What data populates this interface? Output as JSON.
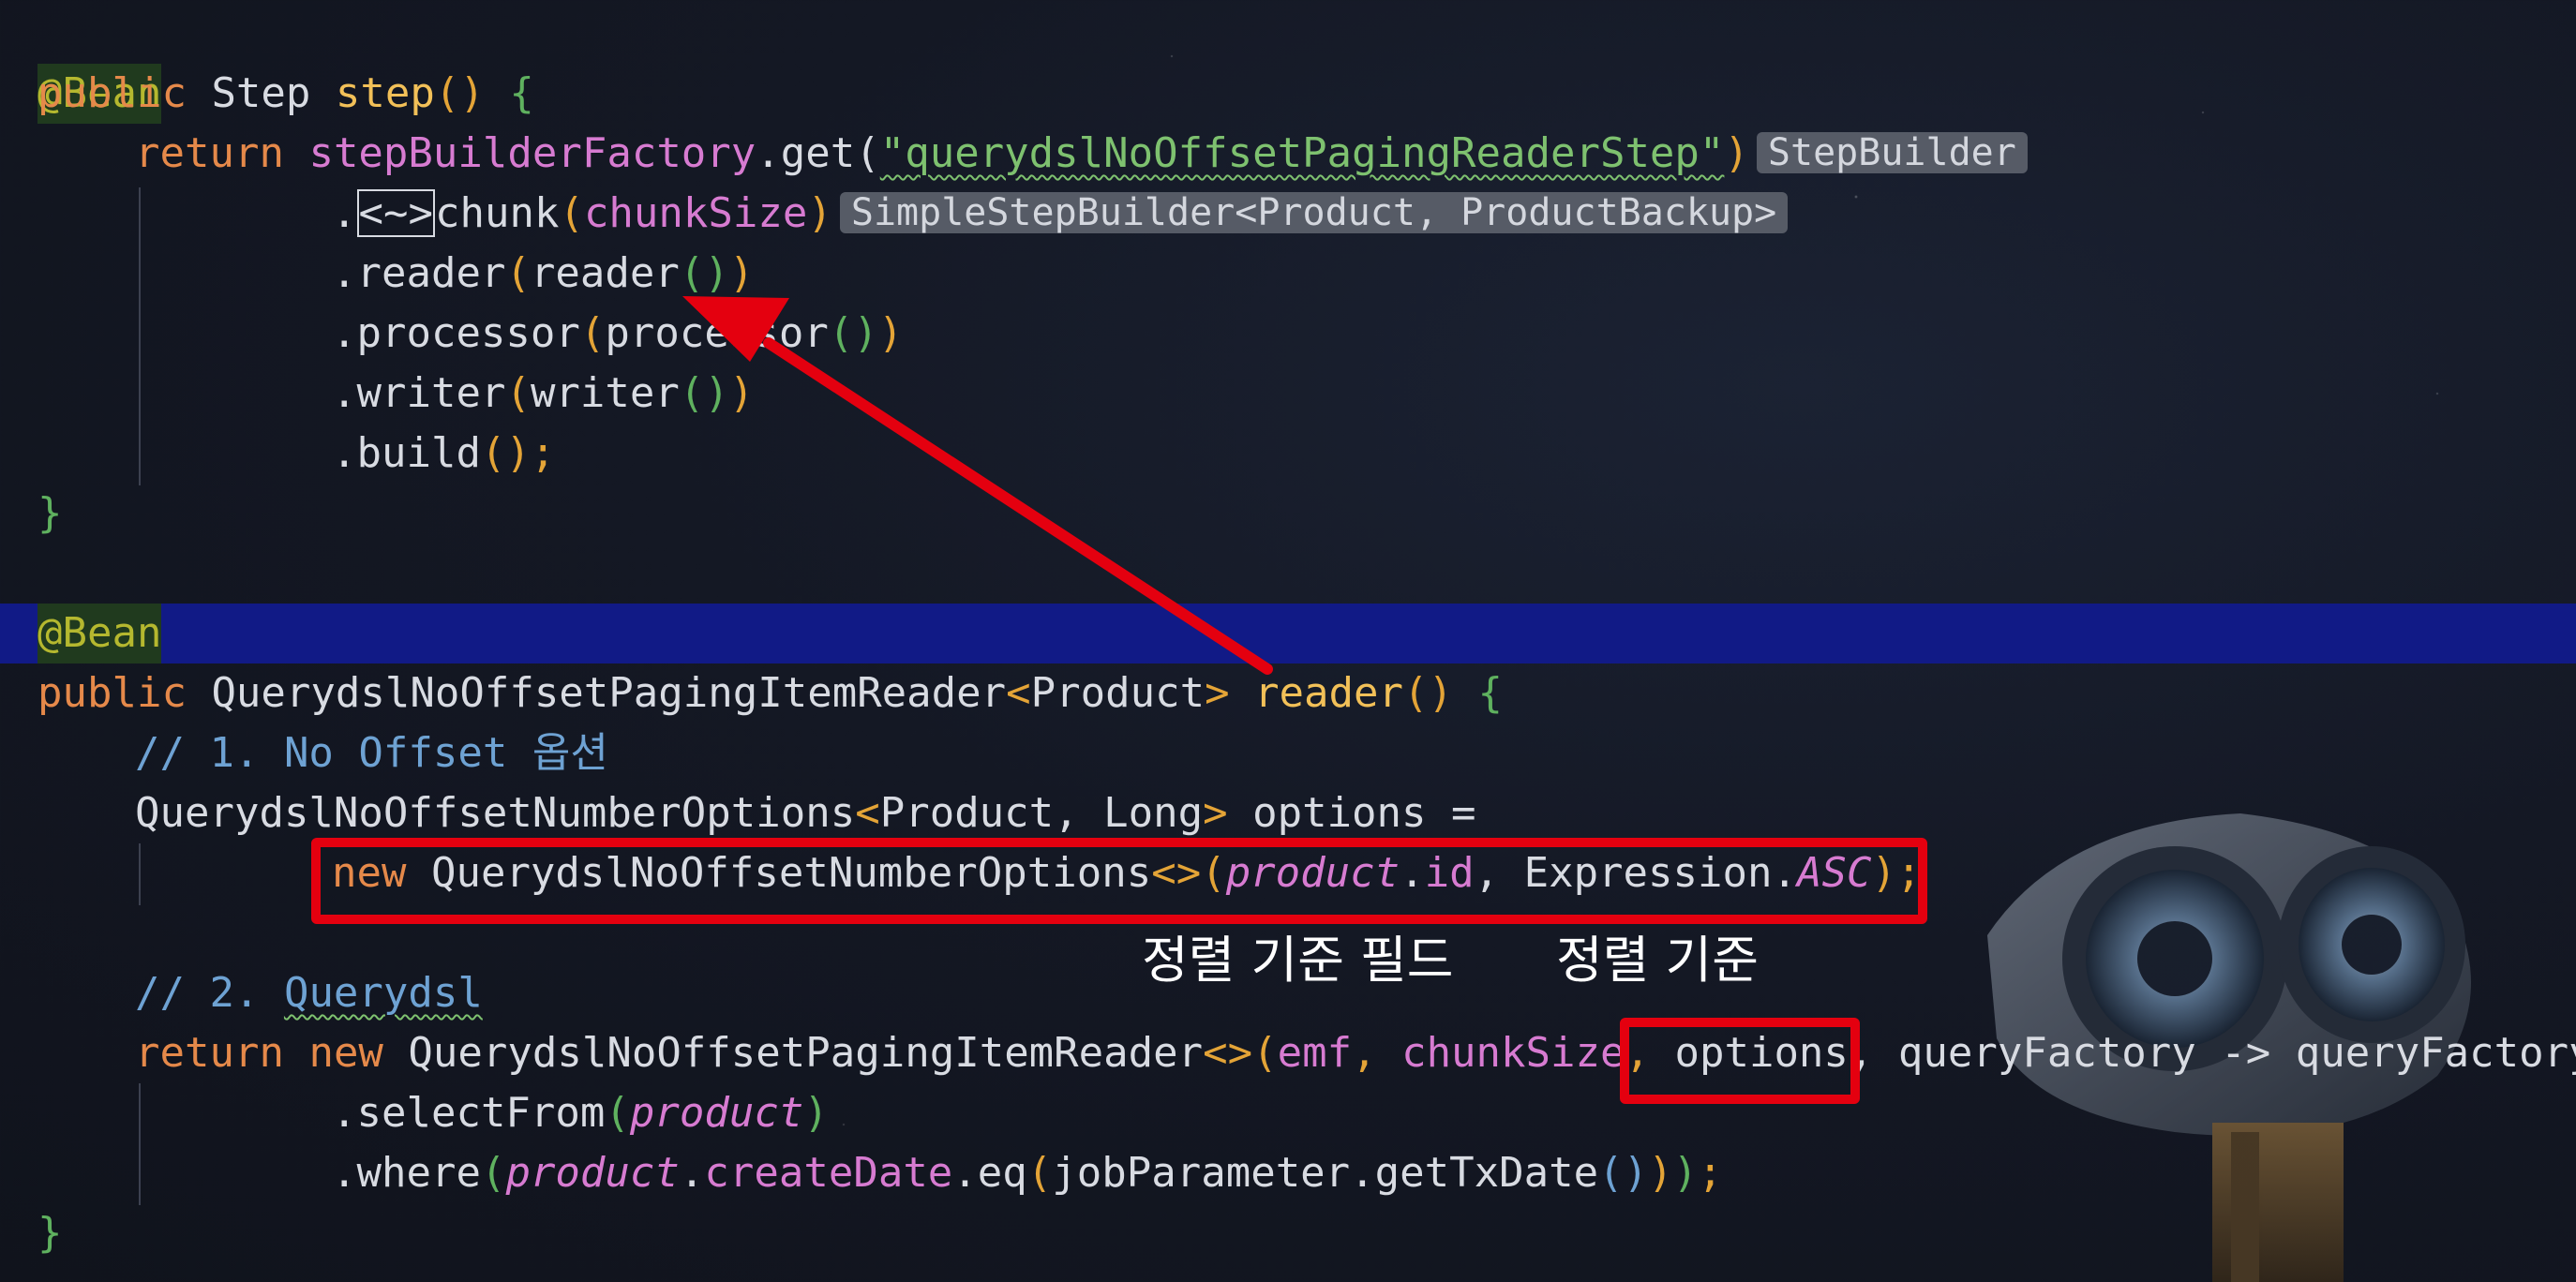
{
  "colors": {
    "background": "#141824",
    "keyword": "#e5894a",
    "method": "#f2c058",
    "field": "#d77bd1",
    "string": "#7ec16f",
    "comment": "#6ea2d3",
    "selected_line": "#111a86",
    "annotation_red": "#e4000f"
  },
  "code": {
    "l1": {
      "ann": "@Bean"
    },
    "l2": {
      "kw": "public",
      "t1": " Step ",
      "fn": "step",
      "t2": "() ",
      "br": "{"
    },
    "l3": {
      "kw": "return",
      "fld": "stepBuilderFactory",
      "t1": ".get(",
      "str": "\"querydslNoOffsetPagingReaderStep\"",
      "t2": ")",
      "hint": "StepBuilder"
    },
    "l4": {
      "dot": ".",
      "diamond": "<~>",
      "t1": "chunk",
      "p1": "(",
      "fld": "chunkSize",
      "p2": ")",
      "hint": "SimpleStepBuilder<Product, ProductBackup>"
    },
    "l5": {
      "t1": ".reader",
      "p1": "(",
      "t2": "reader",
      "g": "()",
      "p2": ")"
    },
    "l6": {
      "t1": ".processor",
      "p1": "(",
      "t2": "processor",
      "g": "()",
      "p2": ")"
    },
    "l7": {
      "t1": ".writer",
      "p1": "(",
      "t2": "writer",
      "g": "()",
      "p2": ")"
    },
    "l8": {
      "t1": ".build",
      "p1": "()",
      "t2": ";"
    },
    "l9": {
      "br": "}"
    },
    "l11": {
      "ann": "@Bean"
    },
    "l12": {
      "kw": "public",
      "t1": " QuerydslNoOffsetPagingItemReader",
      "lt": "<",
      "t2": "Product",
      "gt": ">",
      "fn": " reader",
      "t3": "() ",
      "br": "{"
    },
    "l13": {
      "cmt": "// 1. No Offset 옵션"
    },
    "l14": {
      "t1": "QuerydslNoOffsetNumberOptions",
      "lt": "<",
      "t2": "Product, Long",
      "gt": ">",
      "t3": " options ="
    },
    "l15": {
      "kw": "new",
      "t1": " QuerydslNoOffsetNumberOptions",
      "d": "<>",
      "p1": "(",
      "fldi": "product",
      "t2": ".",
      "fld": "id",
      "t3": ", Expression.",
      "asc": "ASC",
      "p2": ")",
      "t4": ";"
    },
    "l17": {
      "cmt1": "// 2. ",
      "cmt2": "Querydsl"
    },
    "l18": {
      "kw1": "return",
      "kw2": "new",
      "t1": " QuerydslNoOffsetPagingItemReader",
      "d": "<>",
      "p1": "(",
      "f1": "emf",
      "c1": ", ",
      "f2": "chunkSize",
      "c2": ", ",
      "opt": "options,",
      "t2": " queryFactory -> queryFactory"
    },
    "l19": {
      "t1": ".selectFrom",
      "p1": "(",
      "fldi": "product",
      "p2": ")"
    },
    "l20": {
      "t1": ".where",
      "p1": "(",
      "fldi": "product",
      "t2": ".",
      "fld": "createDate",
      "t3": ".eq",
      "p2": "(",
      "t4": "jobParameter",
      "t5": ".getTxDate",
      "g": "()",
      "p3": ")",
      "p4": ")",
      "t6": ";"
    },
    "l21": {
      "br": "}"
    }
  },
  "annotations": {
    "sort_field_label": "정렬 기준 필드",
    "sort_order_label": "정렬 기준"
  }
}
